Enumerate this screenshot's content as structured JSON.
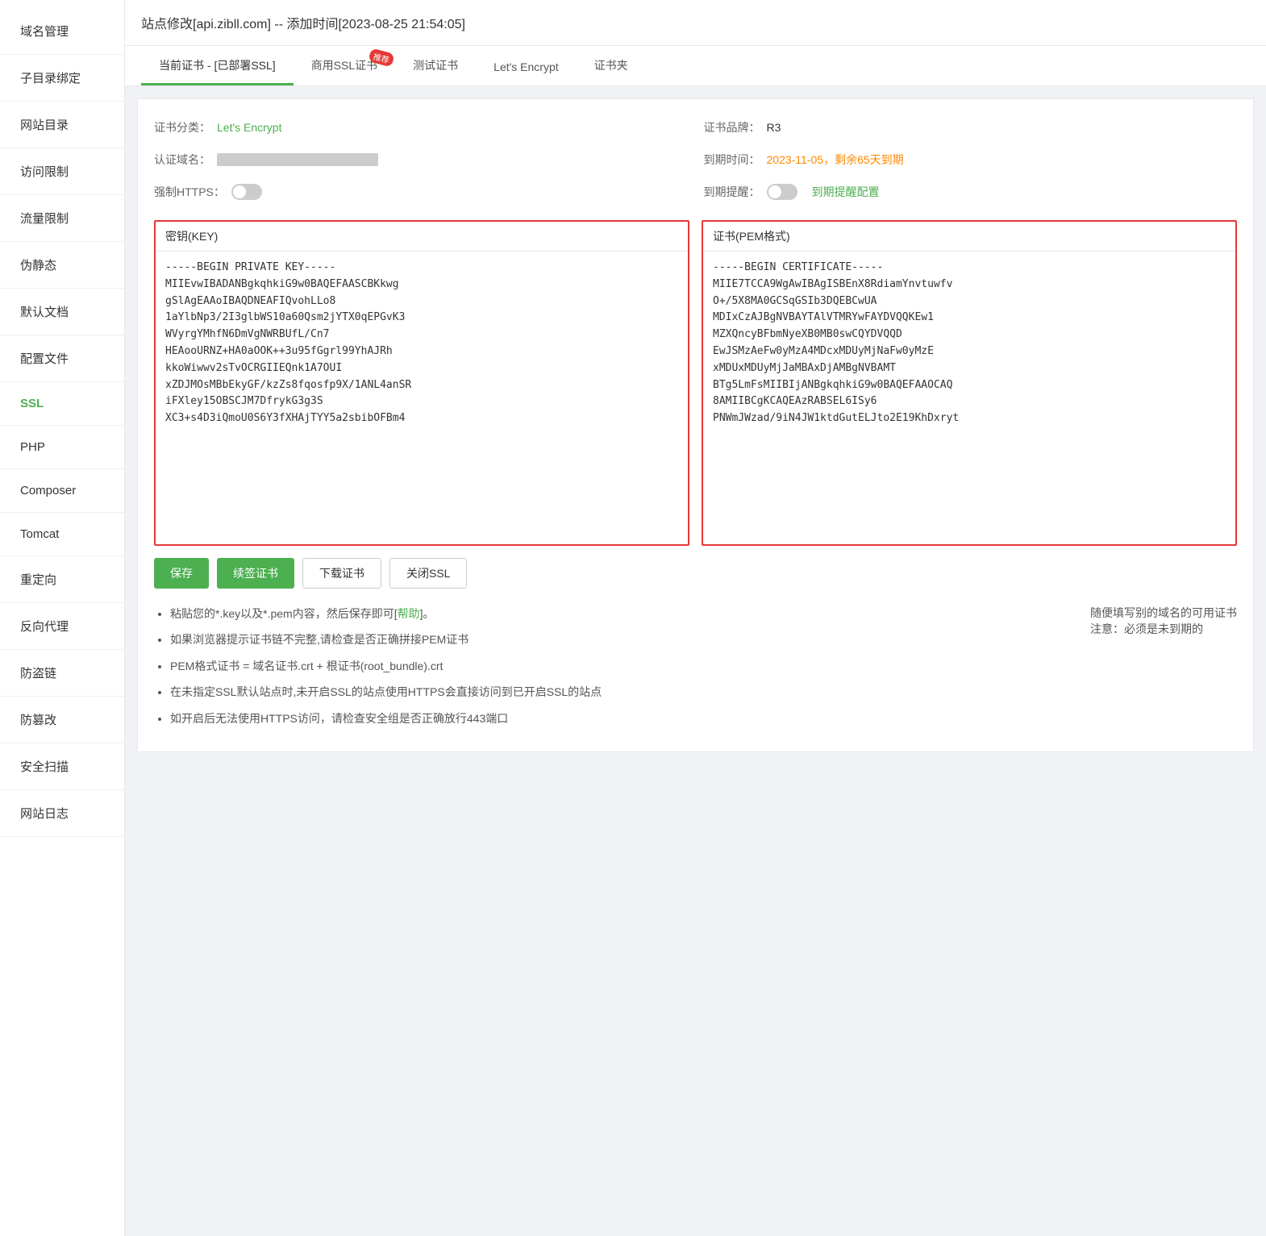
{
  "title_bar": "站点修改[api.zibll.com] -- 添加时间[2023-08-25 21:54:05]",
  "sidebar": {
    "items": [
      {
        "id": "domain",
        "label": "域名管理"
      },
      {
        "id": "subdirectory",
        "label": "子目录绑定"
      },
      {
        "id": "website-dir",
        "label": "网站目录"
      },
      {
        "id": "access",
        "label": "访问限制"
      },
      {
        "id": "traffic",
        "label": "流量限制"
      },
      {
        "id": "pseudo-static",
        "label": "伪静态"
      },
      {
        "id": "default-doc",
        "label": "默认文档"
      },
      {
        "id": "config-file",
        "label": "配置文件"
      },
      {
        "id": "ssl",
        "label": "SSL",
        "active": true
      },
      {
        "id": "php",
        "label": "PHP"
      },
      {
        "id": "composer",
        "label": "Composer"
      },
      {
        "id": "tomcat",
        "label": "Tomcat"
      },
      {
        "id": "redirect",
        "label": "重定向"
      },
      {
        "id": "reverse-proxy",
        "label": "反向代理"
      },
      {
        "id": "anti-hotlink",
        "label": "防盗链"
      },
      {
        "id": "anti-tamper",
        "label": "防篡改"
      },
      {
        "id": "security-scan",
        "label": "安全扫描"
      },
      {
        "id": "website-log",
        "label": "网站日志"
      }
    ]
  },
  "tabs": [
    {
      "id": "current-cert",
      "label": "当前证书 - [已部署SSL]",
      "active": true,
      "badge": null
    },
    {
      "id": "commercial-ssl",
      "label": "商用SSL证书",
      "active": false,
      "badge": "推荐"
    },
    {
      "id": "test-cert",
      "label": "测试证书",
      "active": false,
      "badge": null
    },
    {
      "id": "lets-encrypt",
      "label": "Let's Encrypt",
      "active": false,
      "badge": null
    },
    {
      "id": "cert-folder",
      "label": "证书夹",
      "active": false,
      "badge": null
    }
  ],
  "cert_info": {
    "type_label": "证书分类：",
    "type_value": "Let's Encrypt",
    "brand_label": "证书品牌：",
    "brand_value": "R3",
    "domain_label": "认证域名：",
    "domain_value": "",
    "expire_label": "到期时间：",
    "expire_value": "2023-11-05，剩余65天到期",
    "https_label": "强制HTTPS：",
    "reminder_label": "到期提醒：",
    "reminder_link": "到期提醒配置"
  },
  "key_box": {
    "label": "密钥(KEY)",
    "content": "-----BEGIN PRIVATE KEY-----\nMIIEvwIBADANBgkqhkiG9w0BAQEFAASCBKkwg\ngSlAgEAAoIBAQDNEAFIQvohLLo8\n1aYlbNp3/2I3glbWS10a60Qsm2jYTX0qEPGvK3\nWVyrgYMhfN6DmVgNWRBUfL/Cn7\nHEAooURNZ+HA0aOOK++3u95fGgrl99YhAJRh\nkkoWiwwv2sTvOCRGIIEQnk1A7OUI\nxZDJMOsMBbEkyGF/kzZs8fqosfp9X/1ANL4anSR\niFXley15OBSCJM7DfrykG3g3S\nXC3+s4D3iQmoU0S6Y3fXHAjTYY5a2sbibOFBm4"
  },
  "cert_box": {
    "label": "证书(PEM格式)",
    "content": "-----BEGIN CERTIFICATE-----\nMIIE7TCCA9WgAwIBAgISBEnX8RdiamYnvtuwfv\nO+/5X8MA0GCSqGSIb3DQEBCwUA\nMDIxCzAJBgNVBAYTAlVTMRYwFAYDVQQKEw1\nMZXQncyBFbmNyeXB0MB0swCQYDVQQD\nEwJSMzAeFw0yMzA4MDcxMDUyMjNaFw0yMzE\nxMDUxMDUyMjJaMBAxDjAMBgNVBAMT\nBTg5LmFsMIIBIjANBgkqhkiG9w0BAQEFAAOCAQ\n8AMIIBCgKCAQEAzRABSEL6ISy6\nPNWmJWzad/9iN4JW1ktdGutELJto2E19KhDxryt"
  },
  "buttons": {
    "save": "保存",
    "renew": "续签证书",
    "download": "下载证书",
    "close_ssl": "关闭SSL"
  },
  "notes": {
    "items": [
      "粘贴您的*.key以及*.pem内容，然后保存即可[帮助]。",
      "如果浏览器提示证书链不完整,请检查是否正确拼接PEM证书",
      "PEM格式证书 = 域名证书.crt + 根证书(root_bundle).crt",
      "在未指定SSL默认站点时,未开启SSL的站点使用HTTPS会直接访问到已开启SSL的站点",
      "如开启后无法使用HTTPS访问，请检查安全组是否正确放行443端口"
    ],
    "help_link": "帮助",
    "red_note_line1": "随便填写别的域名的可用证书",
    "red_note_line2": "注意：必须是未到期的"
  }
}
